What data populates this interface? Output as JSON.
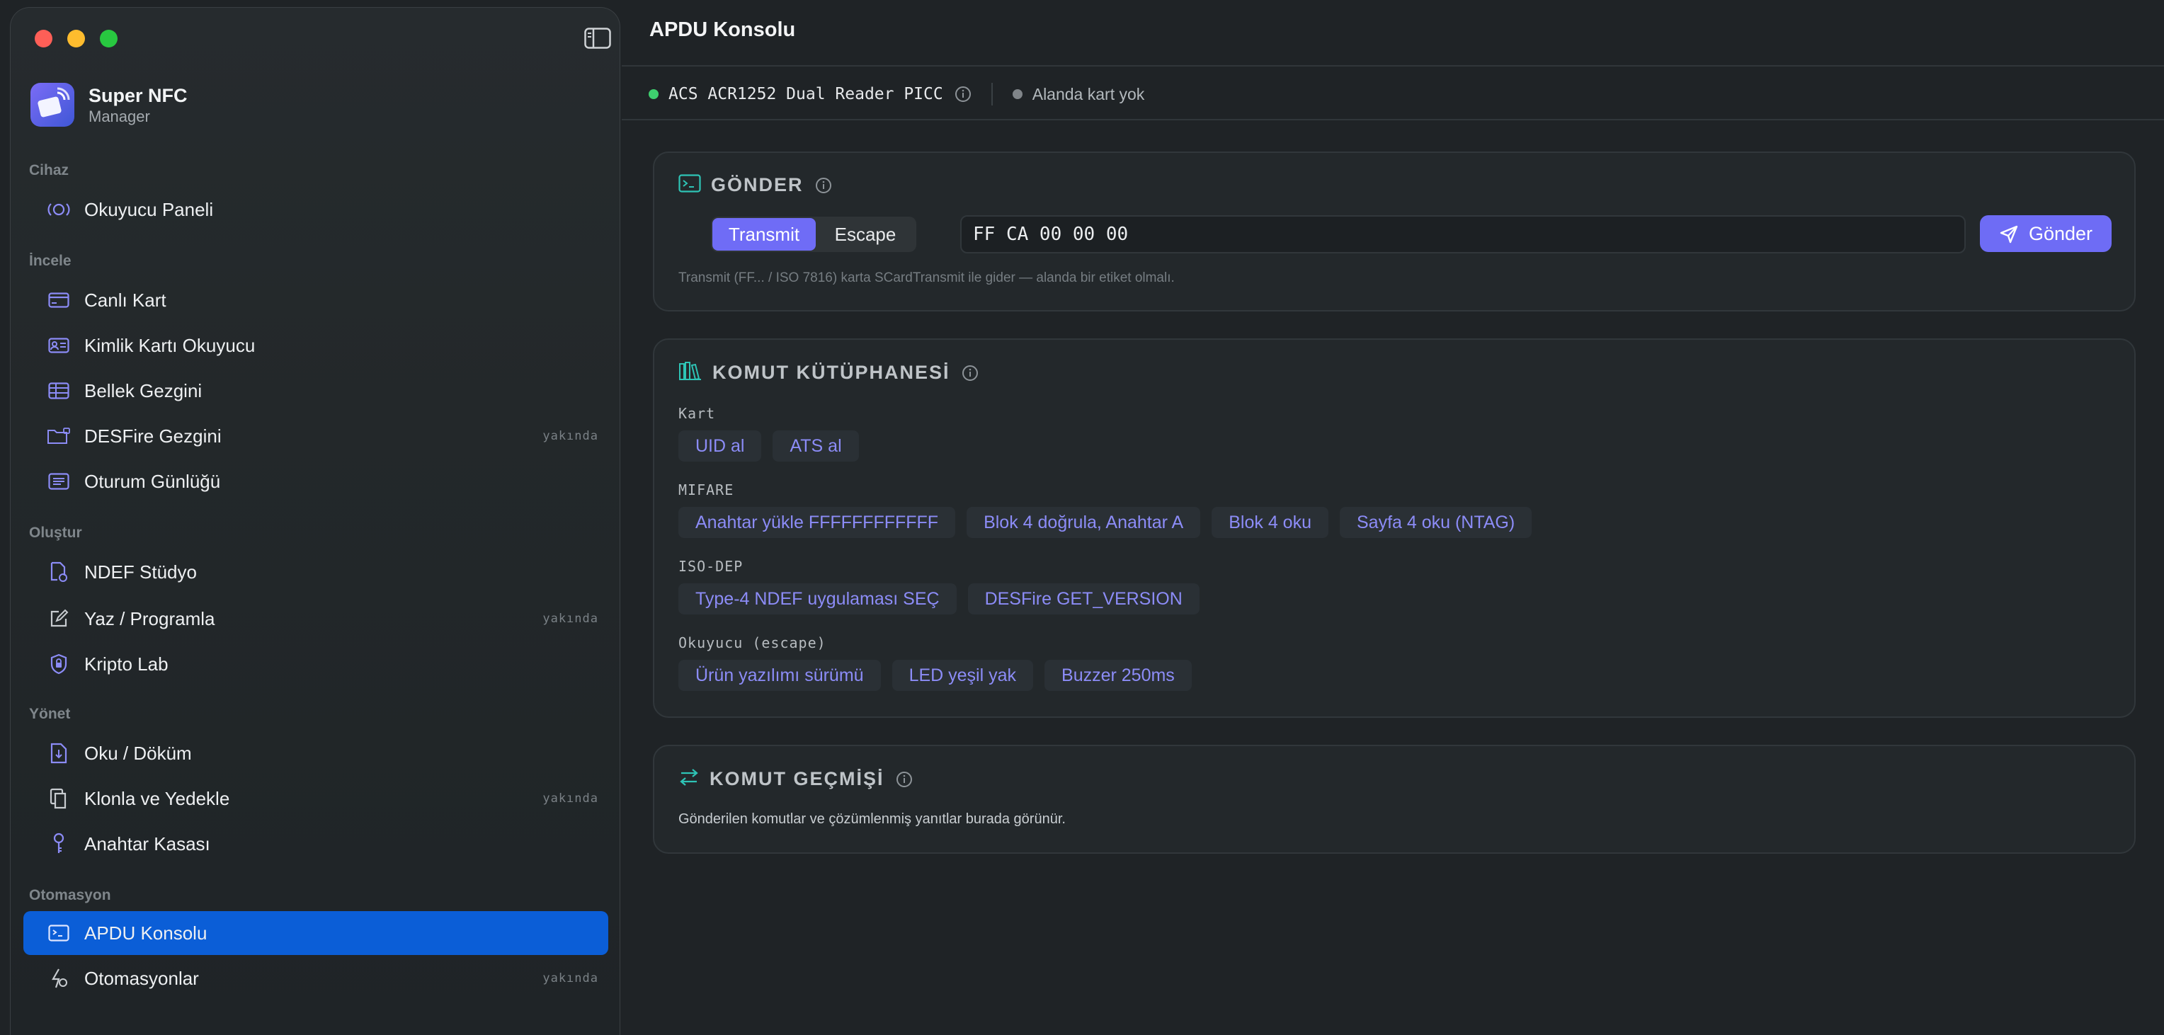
{
  "app": {
    "name": "Super NFC",
    "subtitle": "Manager"
  },
  "sidebar": {
    "sections": [
      {
        "title": "Cihaz",
        "items": [
          {
            "label": "Okuyucu Paneli",
            "icon": "reader-waves-icon",
            "soon": ""
          }
        ]
      },
      {
        "title": "İncele",
        "items": [
          {
            "label": "Canlı Kart",
            "icon": "credit-card-icon",
            "soon": ""
          },
          {
            "label": "Kimlik Kartı Okuyucu",
            "icon": "id-card-icon",
            "soon": ""
          },
          {
            "label": "Bellek Gezgini",
            "icon": "table-grid-icon",
            "soon": ""
          },
          {
            "label": "DESFire Gezgini",
            "icon": "folder-lock-icon",
            "soon": "yakında"
          },
          {
            "label": "Oturum Günlüğü",
            "icon": "list-log-icon",
            "soon": ""
          }
        ]
      },
      {
        "title": "Oluştur",
        "items": [
          {
            "label": "NDEF Stüdyo",
            "icon": "document-gear-icon",
            "soon": ""
          },
          {
            "label": "Yaz / Programla",
            "icon": "edit-square-icon",
            "soon": "yakında"
          },
          {
            "label": "Kripto Lab",
            "icon": "shield-lock-icon",
            "soon": ""
          }
        ]
      },
      {
        "title": "Yönet",
        "items": [
          {
            "label": "Oku / Döküm",
            "icon": "download-doc-icon",
            "soon": ""
          },
          {
            "label": "Klonla ve Yedekle",
            "icon": "copy-doc-icon",
            "soon": "yakında"
          },
          {
            "label": "Anahtar Kasası",
            "icon": "key-icon",
            "soon": ""
          }
        ]
      },
      {
        "title": "Otomasyon",
        "items": [
          {
            "label": "APDU Konsolu",
            "icon": "terminal-icon",
            "soon": ""
          },
          {
            "label": "Otomasyonlar",
            "icon": "automation-icon",
            "soon": "yakında"
          }
        ]
      }
    ],
    "active_item": "APDU Konsolu"
  },
  "main": {
    "title": "APDU Konsolu",
    "status": {
      "reader": "ACS ACR1252 Dual Reader PICC",
      "reader_color": "#3ecf6e",
      "card": "Alanda kart yok",
      "card_color": "#808589"
    },
    "send": {
      "title": "GÖNDER",
      "modes": [
        "Transmit",
        "Escape"
      ],
      "selected_mode": "Transmit",
      "apdu_value": "FF CA 00 00 00",
      "send_label": "Gönder",
      "hint": "Transmit (FF... / ISO 7816) karta SCardTransmit ile gider — alanda bir etiket olmalı."
    },
    "library": {
      "title": "KOMUT KÜTÜPHANESİ",
      "groups": [
        {
          "label": "Kart",
          "chips": [
            "UID al",
            "ATS al"
          ]
        },
        {
          "label": "MIFARE",
          "chips": [
            "Anahtar yükle FFFFFFFFFFFF",
            "Blok 4 doğrula, Anahtar A",
            "Blok 4 oku",
            "Sayfa 4 oku (NTAG)"
          ]
        },
        {
          "label": "ISO-DEP",
          "chips": [
            "Type-4 NDEF uygulaması SEÇ",
            "DESFire GET_VERSION"
          ]
        },
        {
          "label": "Okuyucu (escape)",
          "chips": [
            "Ürün yazılımı sürümü",
            "LED yeşil yak",
            "Buzzer 250ms"
          ]
        }
      ]
    },
    "history": {
      "title": "KOMUT GEÇMİŞİ",
      "empty_text": "Gönderilen komutlar ve çözümlenmiş yanıtlar burada görünür."
    }
  },
  "colors": {
    "accent": "#6e6cf5",
    "active_nav": "#0b5ed7",
    "teal_icon": "#2ec4b6"
  }
}
